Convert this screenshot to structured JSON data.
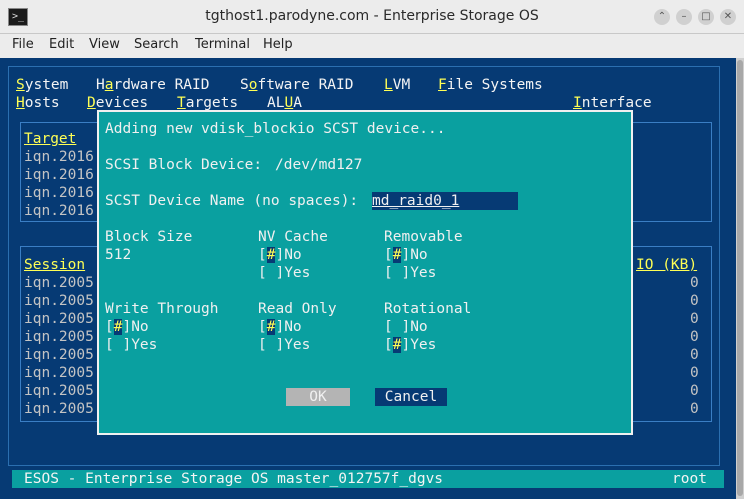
{
  "window": {
    "title": "tgthost1.parodyne.com - Enterprise Storage OS",
    "controls": [
      "⌃",
      "–",
      "□",
      "✕"
    ]
  },
  "menubar": [
    "File",
    "Edit",
    "View",
    "Search",
    "Terminal",
    "Help"
  ],
  "tui_menu": {
    "row1": [
      {
        "hot": "S",
        "rest": "ystem"
      },
      {
        "pre": "H",
        "hot": "a",
        "rest": "rdware RAID"
      },
      {
        "pre": "S",
        "hot": "o",
        "rest": "ftware RAID"
      },
      {
        "hot": "L",
        "rest": "VM"
      },
      {
        "hot": "F",
        "rest": "ile Systems"
      }
    ],
    "row2": [
      {
        "hot": "H",
        "rest": "osts"
      },
      {
        "hot": "D",
        "rest": "evices"
      },
      {
        "hot": "T",
        "rest": "argets"
      },
      {
        "pre": "AL",
        "hot": "U",
        "rest": "A"
      },
      {
        "hot": "I",
        "rest": "nterface"
      }
    ]
  },
  "targets_panel": {
    "header": "Target",
    "rows": [
      "iqn.2016",
      "iqn.2016",
      "iqn.2016",
      "iqn.2016"
    ]
  },
  "sessions_panel": {
    "header": "Session",
    "io_header": "IO (KB)",
    "rows": [
      "iqn.2005",
      "iqn.2005",
      "iqn.2005",
      "iqn.2005",
      "iqn.2005",
      "iqn.2005",
      "iqn.2005",
      "iqn.2005"
    ],
    "io_values": [
      "0",
      "0",
      "0",
      "0",
      "0",
      "0",
      "0",
      "0"
    ]
  },
  "dialog": {
    "title": "Adding new vdisk_blockio SCST device...",
    "block_device_label": "SCSI Block Device:",
    "block_device_value": "/dev/md127",
    "device_name_label": "SCST Device Name (no spaces):",
    "device_name_value": "md_raid0_1",
    "block_size_label": "Block Size",
    "block_size_value": "512",
    "nv_cache_label": "NV Cache",
    "removable_label": "Removable",
    "write_through_label": "Write Through",
    "read_only_label": "Read Only",
    "rotational_label": "Rotational",
    "no_label": "No",
    "yes_label": "Yes",
    "checked_mark": "#",
    "ok_label": "OK",
    "cancel_label": "Cancel"
  },
  "statusbar": {
    "left": "ESOS - Enterprise Storage OS master_012757f_dgvs",
    "right": "root"
  }
}
